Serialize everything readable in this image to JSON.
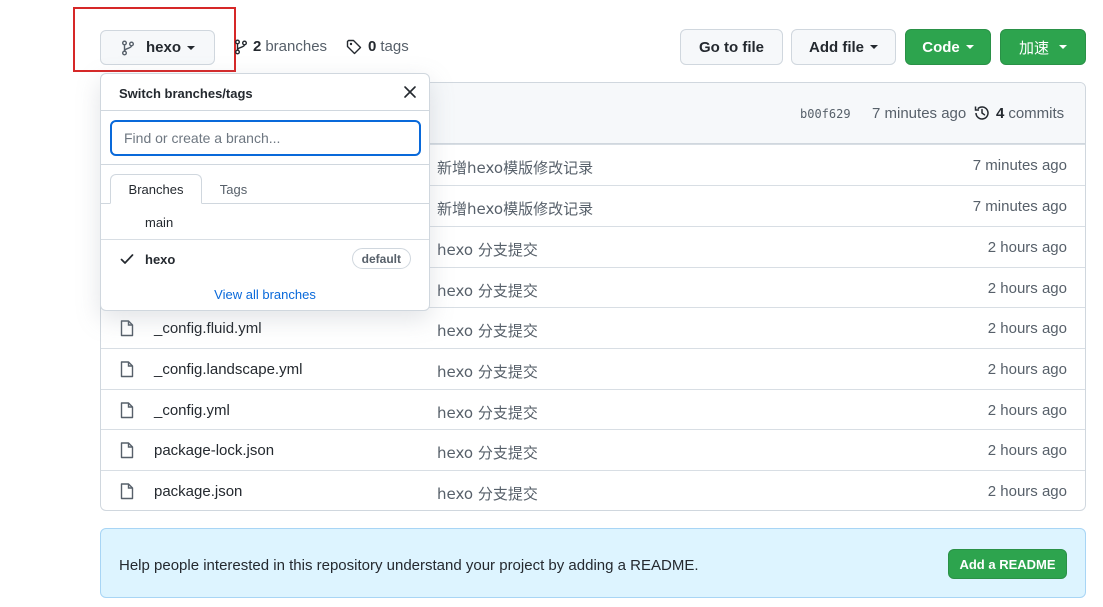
{
  "toolbar": {
    "branch_button": {
      "label": "hexo"
    },
    "branches": {
      "count": "2",
      "label": "branches"
    },
    "tags": {
      "count": "0",
      "label": "tags"
    },
    "go_to_file": "Go to file",
    "add_file": "Add file",
    "code": "Code",
    "accelerate": "加速"
  },
  "commit_bar": {
    "hash": "b00f629",
    "time": "7 minutes ago",
    "commits_count": "4",
    "commits_label": "commits"
  },
  "files": [
    {
      "name": "",
      "message": "新增hexo模版修改记录",
      "time": "7 minutes ago"
    },
    {
      "name": "",
      "message": "新增hexo模版修改记录",
      "time": "7 minutes ago"
    },
    {
      "name": "",
      "message": "hexo 分支提交",
      "time": "2 hours ago"
    },
    {
      "name": "",
      "message": "hexo 分支提交",
      "time": "2 hours ago"
    },
    {
      "name": "_config.fluid.yml",
      "message": "hexo 分支提交",
      "time": "2 hours ago"
    },
    {
      "name": "_config.landscape.yml",
      "message": "hexo 分支提交",
      "time": "2 hours ago"
    },
    {
      "name": "_config.yml",
      "message": "hexo 分支提交",
      "time": "2 hours ago"
    },
    {
      "name": "package-lock.json",
      "message": "hexo 分支提交",
      "time": "2 hours ago"
    },
    {
      "name": "package.json",
      "message": "hexo 分支提交",
      "time": "2 hours ago"
    }
  ],
  "readme_banner": {
    "text": "Help people interested in this repository understand your project by adding a README.",
    "button": "Add a README"
  },
  "dropdown": {
    "title": "Switch branches/tags",
    "search_placeholder": "Find or create a branch...",
    "tabs": [
      "Branches",
      "Tags"
    ],
    "branches": [
      {
        "name": "main",
        "selected": false
      },
      {
        "name": "hexo",
        "selected": true,
        "badge": "default"
      }
    ],
    "view_all": "View all branches"
  },
  "colors": {
    "primary_green": "#2da44e",
    "link_blue": "#0969da",
    "highlight_red": "#d62828",
    "banner_bg": "#ddf4ff"
  },
  "icons": {
    "branch": "git-branch-icon",
    "tag": "tag-icon",
    "file": "file-icon",
    "history": "history-icon",
    "close": "close-icon",
    "check": "check-icon"
  }
}
